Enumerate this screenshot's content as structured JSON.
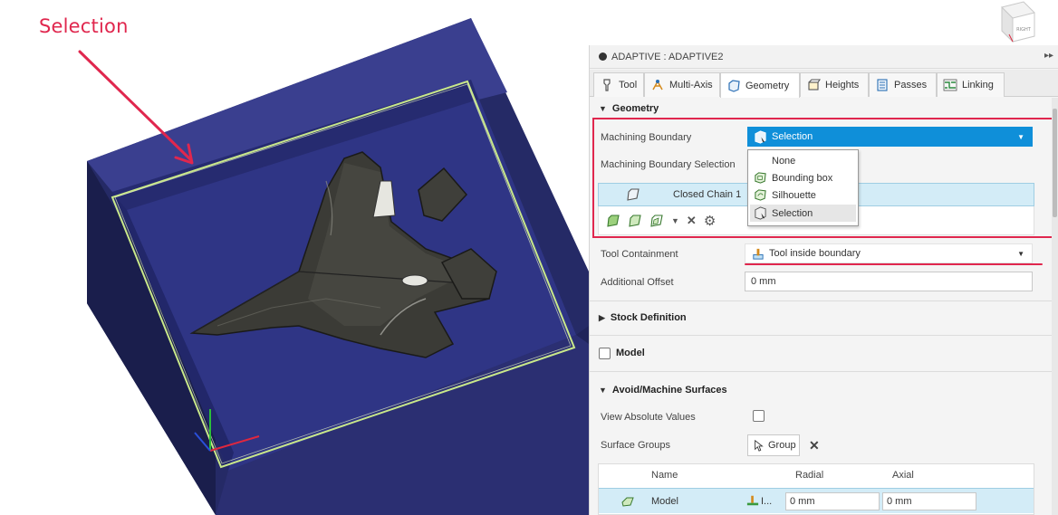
{
  "annotation": {
    "label": "Selection",
    "color": "#e0274e"
  },
  "viewcube": {
    "face_label": "RIGHT"
  },
  "panel": {
    "title": "ADAPTIVE : ADAPTIVE2",
    "tabs": [
      {
        "label": "Tool",
        "icon": "tool-icon"
      },
      {
        "label": "Multi-Axis",
        "icon": "multi-axis-icon"
      },
      {
        "label": "Geometry",
        "icon": "geometry-icon",
        "active": true
      },
      {
        "label": "Heights",
        "icon": "heights-icon"
      },
      {
        "label": "Passes",
        "icon": "passes-icon"
      },
      {
        "label": "Linking",
        "icon": "linking-icon"
      }
    ],
    "geometry": {
      "heading": "Geometry",
      "machining_boundary_label": "Machining Boundary",
      "machining_boundary_value": "Selection",
      "machining_boundary_selection_label": "Machining Boundary Selection",
      "chain_label": "Closed Chain 1",
      "chain_tool_icons": [
        "chain-icon",
        "face-chain-icon",
        "silhouette-chain-icon",
        "dropdown-caret-icon",
        "clear-icon",
        "settings-gear-icon"
      ],
      "dropdown_options": [
        {
          "label": "None",
          "icon": ""
        },
        {
          "label": "Bounding box",
          "icon": "bounding-box-icon"
        },
        {
          "label": "Silhouette",
          "icon": "silhouette-icon"
        },
        {
          "label": "Selection",
          "icon": "selection-icon",
          "selected": true
        }
      ],
      "tool_containment_label": "Tool Containment",
      "tool_containment_value": "Tool inside boundary",
      "additional_offset_label": "Additional Offset",
      "additional_offset_value": "0 mm"
    },
    "stock_definition": {
      "heading": "Stock Definition"
    },
    "model": {
      "heading": "Model",
      "checked": false
    },
    "avoid_machine_surfaces": {
      "heading": "Avoid/Machine Surfaces",
      "view_absolute_values_label": "View Absolute Values",
      "view_absolute_values_checked": false,
      "surface_groups_label": "Surface Groups",
      "group_button_label": "Group",
      "table": {
        "headers": [
          "Name",
          "Radial",
          "Axial"
        ],
        "rows": [
          {
            "name": "Model",
            "tool_abbrev": "I...",
            "radial": "0 mm",
            "axial": "0 mm"
          }
        ]
      }
    }
  },
  "colors": {
    "accent_blue": "#0f8fd9",
    "highlight_row": "#d3ecf7",
    "annotation_red": "#e0274e",
    "stock_navy": "#2b2f72",
    "boundary_green": "#c9e88a"
  }
}
